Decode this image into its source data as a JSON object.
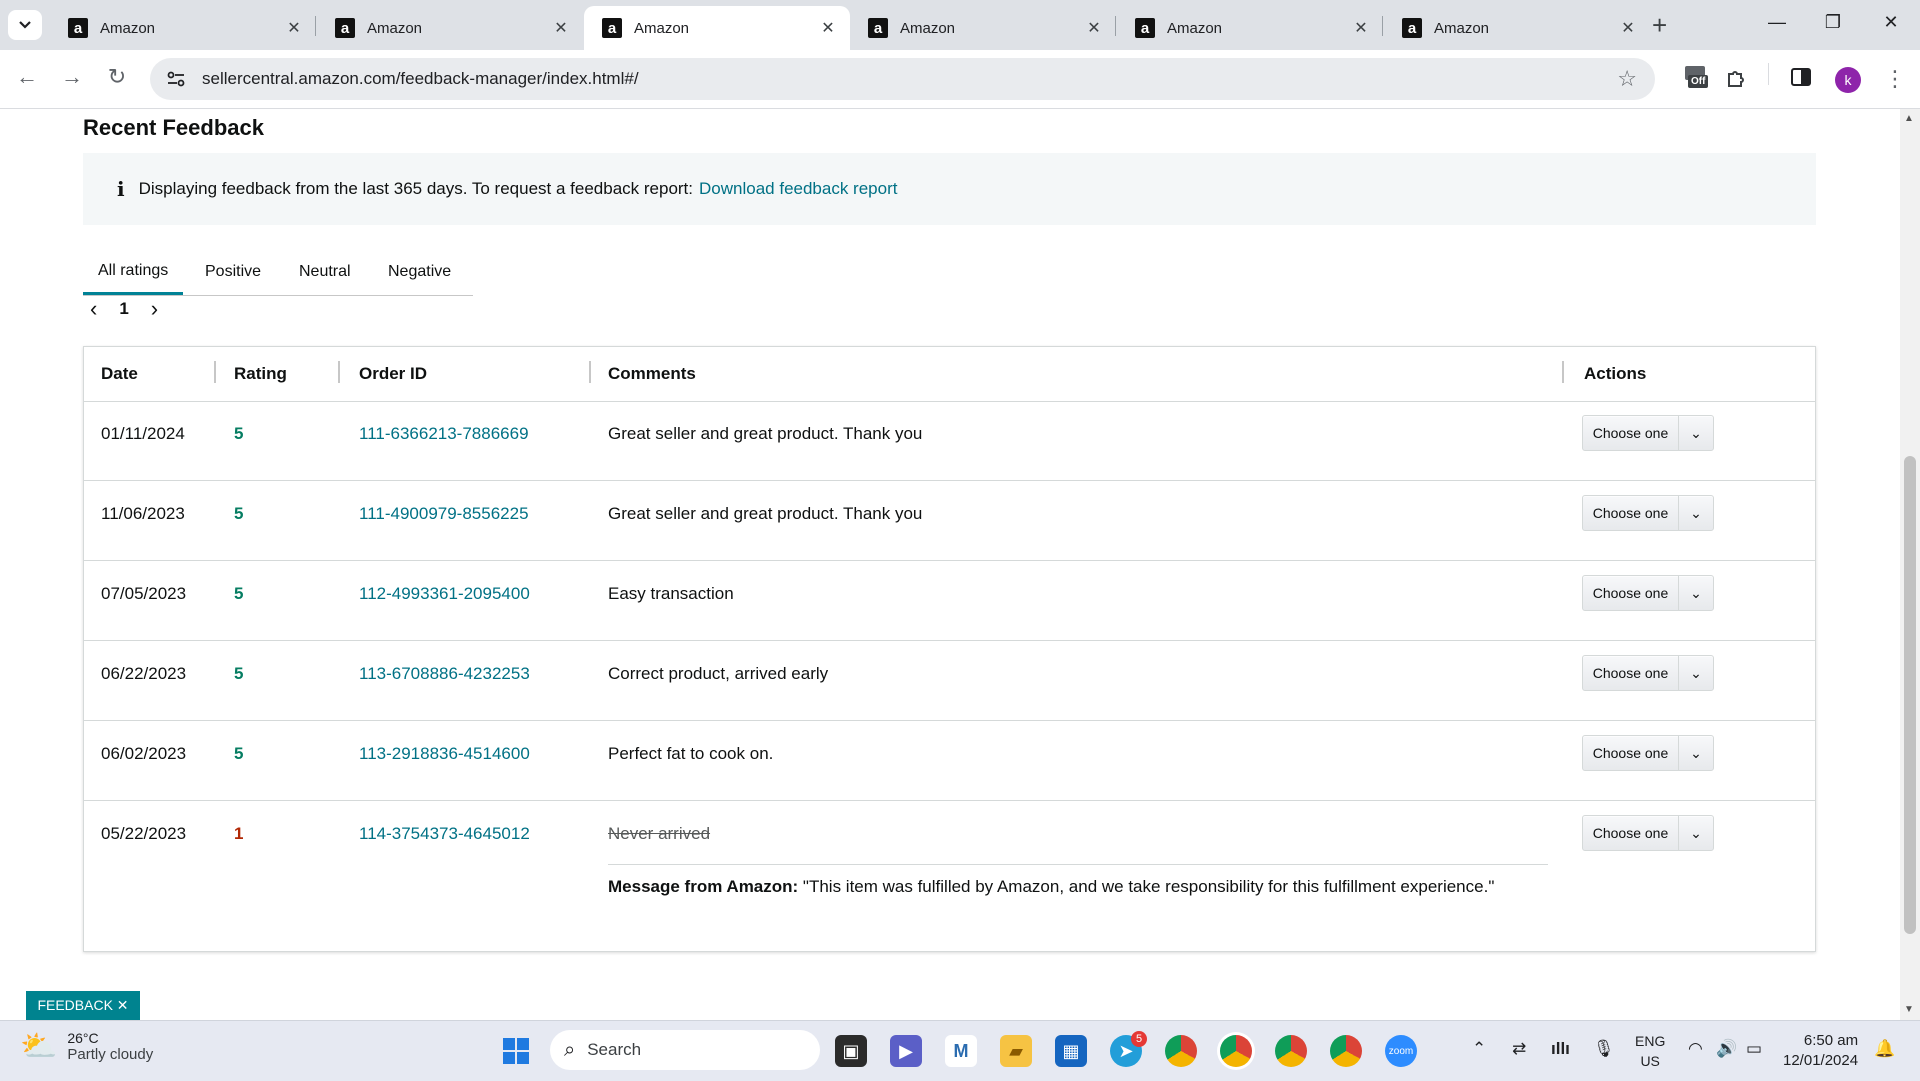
{
  "browser": {
    "tabs": [
      {
        "title": "Amazon"
      },
      {
        "title": "Amazon"
      },
      {
        "title": "Amazon"
      },
      {
        "title": "Amazon"
      },
      {
        "title": "Amazon"
      },
      {
        "title": "Amazon"
      }
    ],
    "active_tab_index": 2,
    "url": "sellercentral.amazon.com/feedback-manager/index.html#/",
    "profile_initial": "k",
    "extension_badge": "Off"
  },
  "page": {
    "title": "Recent Feedback",
    "alert": {
      "text": "Displaying feedback from the last 365 days. To request a feedback report:",
      "link": "Download feedback report"
    },
    "rating_tabs": [
      "All ratings",
      "Positive",
      "Neutral",
      "Negative"
    ],
    "active_rating_tab": "All ratings",
    "pager": {
      "prev": "‹",
      "page": "1",
      "next": "›"
    },
    "table": {
      "headers": {
        "date": "Date",
        "rating": "Rating",
        "order_id": "Order ID",
        "comments": "Comments",
        "actions": "Actions"
      },
      "action_label": "Choose one",
      "rows": [
        {
          "date": "01/11/2024",
          "rating": "5",
          "order_id": "111-6366213-7886669",
          "comment": "Great seller and great product. Thank you"
        },
        {
          "date": "11/06/2023",
          "rating": "5",
          "order_id": "111-4900979-8556225",
          "comment": "Great seller and great product. Thank you"
        },
        {
          "date": "07/05/2023",
          "rating": "5",
          "order_id": "112-4993361-2095400",
          "comment": "Easy transaction"
        },
        {
          "date": "06/22/2023",
          "rating": "5",
          "order_id": "113-6708886-4232253",
          "comment": "Correct product, arrived early"
        },
        {
          "date": "06/02/2023",
          "rating": "5",
          "order_id": "113-2918836-4514600",
          "comment": "Perfect fat to cook on."
        },
        {
          "date": "05/22/2023",
          "rating": "1",
          "order_id": "114-3754373-4645012",
          "comment": "Never arrived",
          "struck": true,
          "amazon_message_label": "Message from Amazon:",
          "amazon_message": "\"This item was fulfilled by Amazon, and we take responsibility for this fulfillment experience.\""
        }
      ]
    },
    "feedback_button": "FEEDBACK ✕"
  },
  "taskbar": {
    "weather_temp": "26°C",
    "weather_desc": "Partly cloudy",
    "search_placeholder": "Search",
    "telegram_badge": "5",
    "lang_line1": "ENG",
    "lang_line2": "US",
    "time": "6:50 am",
    "date": "12/01/2024"
  },
  "colors": {
    "link": "#007185",
    "positive_rating": "#067d62",
    "negative_rating": "#b12704",
    "tab_underline": "#008296",
    "feedback_button": "#00838f"
  }
}
